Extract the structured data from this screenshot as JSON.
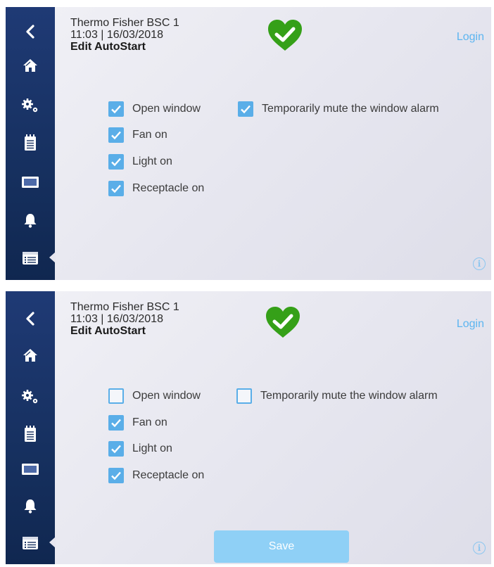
{
  "colors": {
    "sidebar": "#1a3468",
    "accent_blue": "#5aaee8",
    "heart_green": "#35a018",
    "login_blue": "#5cb5f0",
    "save_disabled": "#8fd0f6"
  },
  "sidebar": {
    "icons": [
      "back-chevron-icon",
      "home-icon",
      "settings-gears-icon",
      "notepad-icon",
      "display-icon",
      "bell-icon",
      "schedule-calendar-icon"
    ]
  },
  "screen1": {
    "device_name": "Thermo Fisher BSC 1",
    "datetime": "11:03 | 16/03/2018",
    "page_title": "Edit AutoStart",
    "status_icon": "heart-check-icon",
    "login_label": "Login",
    "options": [
      {
        "label": "Open window",
        "checked": true
      },
      {
        "label": "Fan on",
        "checked": true
      },
      {
        "label": "Light on",
        "checked": true
      },
      {
        "label": "Receptacle on",
        "checked": true
      },
      {
        "label": "Temporarily mute the window alarm",
        "checked": true
      }
    ],
    "info_label": "i"
  },
  "screen2": {
    "device_name": "Thermo Fisher BSC 1",
    "datetime": "11:03 | 16/03/2018",
    "page_title": "Edit AutoStart",
    "status_icon": "heart-check-icon",
    "login_label": "Login",
    "options": [
      {
        "label": "Open window",
        "checked": false
      },
      {
        "label": "Fan on",
        "checked": true
      },
      {
        "label": "Light on",
        "checked": true
      },
      {
        "label": "Receptacle on",
        "checked": true
      },
      {
        "label": "Temporarily mute the window alarm",
        "checked": false
      }
    ],
    "save_label": "Save",
    "info_label": "i"
  }
}
